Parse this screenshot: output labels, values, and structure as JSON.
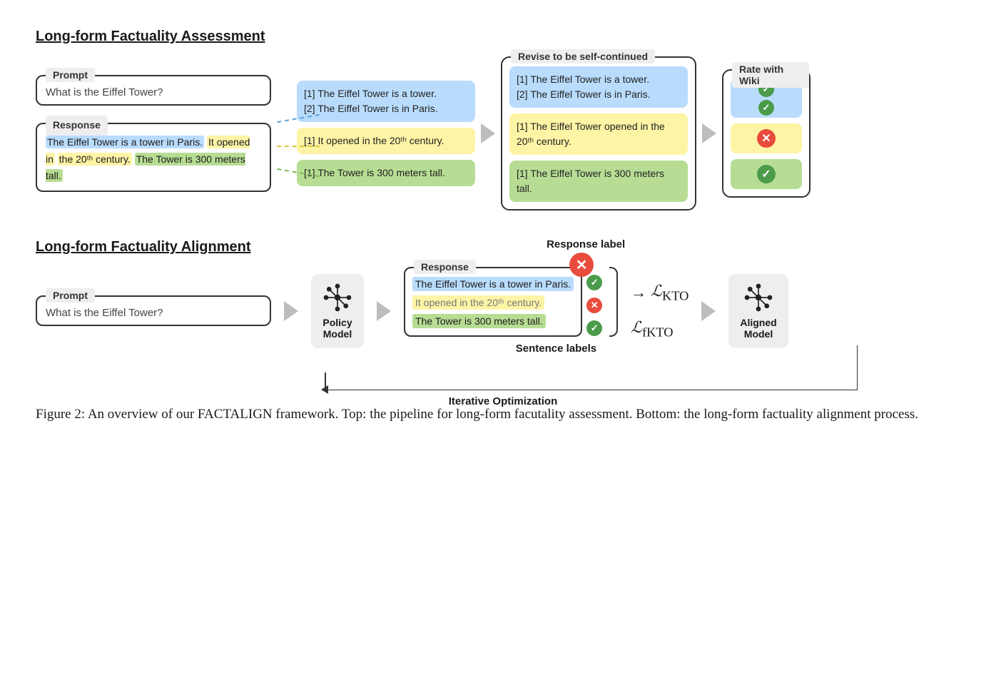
{
  "top": {
    "title": "Long-form Factuality Assessment",
    "prompt_label": "Prompt",
    "prompt_text": "What is the Eiffel Tower?",
    "response_label": "Response",
    "response_parts": {
      "blue": "The Eiffel Tower is a tower in Paris.",
      "yellow_a": "It opened in",
      "yellow_b": "the 20ᵗʰ century.",
      "green": "The Tower is 300 meters tall."
    },
    "decomposed": {
      "blue": [
        "[1] The Eiffel Tower is a tower.",
        "[2] The Eiffel Tower is in Paris."
      ],
      "yellow": [
        "[1] It opened in the 20ᵗʰ century."
      ],
      "green": [
        "[1] The Tower is 300 meters tall."
      ]
    },
    "revise_label": "Revise to be self-continued",
    "revised": {
      "blue": [
        "[1] The Eiffel Tower is a tower.",
        "[2] The Eiffel Tower is in Paris."
      ],
      "yellow": [
        "[1] The Eiffel Tower opened in the 20ᵗʰ century."
      ],
      "green": [
        "[1] The Eiffel Tower is 300 meters tall."
      ]
    },
    "rate_label": "Rate with Wiki",
    "ratings": [
      {
        "color": "blue",
        "mark": "check"
      },
      {
        "color": "blue",
        "mark": "check"
      },
      {
        "color": "yellow",
        "mark": "x"
      },
      {
        "color": "green",
        "mark": "check"
      }
    ]
  },
  "bottom": {
    "title": "Long-form Factuality Alignment",
    "prompt_label": "Prompt",
    "prompt_text": "What is the Eiffel Tower?",
    "policy_label": "Policy\nModel",
    "aligned_label": "Aligned\nModel",
    "response_label": "Response",
    "response_top_label": "Response label",
    "sentence_bottom_label": "Sentence labels",
    "response_lines": [
      {
        "text": "The Eiffel Tower is a tower in Paris.",
        "color": "blue",
        "mark": "check"
      },
      {
        "text": "It opened in the 20ᵗʰ century.",
        "color": "yellow",
        "mark": "x"
      },
      {
        "text": "The Tower is 300 meters tall.",
        "color": "green",
        "mark": "check"
      }
    ],
    "loss_kto": "ℒ_KTO",
    "loss_fkto": "ℒ_fKTO",
    "iter_label": "Iterative Optimization"
  },
  "caption": "Figure 2:  An overview of our FACTALIGN framework.  Top: the pipeline for long-form facutality assessment.  Bottom: the long-form factuality alignment process."
}
